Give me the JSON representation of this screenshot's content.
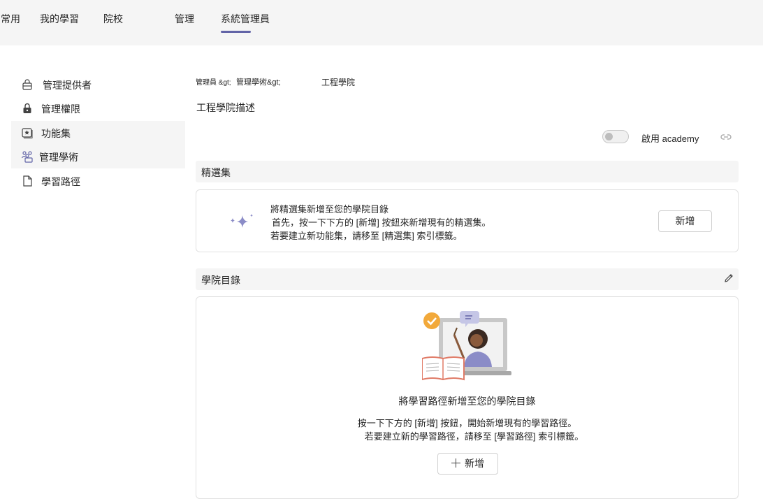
{
  "nav": {
    "tabs": [
      {
        "label": "常用"
      },
      {
        "label": "我的學習"
      },
      {
        "label": "院校"
      },
      {
        "label": "管理"
      },
      {
        "label": "系統管理員"
      }
    ],
    "active_tab": "系統管理員"
  },
  "sidebar": {
    "items": [
      {
        "label": "管理提供者",
        "icon": "provider-icon"
      },
      {
        "label": "管理權限",
        "icon": "lock-icon"
      },
      {
        "label": "功能集",
        "icon": "feature-set-icon"
      },
      {
        "label": "管理學術",
        "icon": "people-icon"
      },
      {
        "label": "學習路徑",
        "icon": "document-icon"
      }
    ],
    "selected": "管理學術"
  },
  "breadcrumb": {
    "part1": "管理員 &gt;",
    "part2": "管理學術&gt;",
    "current": "工程學院"
  },
  "academy": {
    "description": "工程學院描述",
    "toggle_label": "啟用 academy",
    "toggle_on": false
  },
  "featured": {
    "section_title": "精選集",
    "heading": "將精選集新增至您的學院目錄",
    "line1": "首先，按一下下方的 [新增] 按鈕來新增現有的精選集。",
    "line2": "若要建立新功能集，請移至 [精選集] 索引標籤。",
    "button_label": "新增"
  },
  "catalog": {
    "section_title": "學院目錄",
    "heading": "將學習路徑新增至您的學院目錄",
    "line1": "按一下下方的 [新增] 按鈕，開始新增現有的學習路徑。",
    "line2": "若要建立新的學習路徑，請移至 [學習路徑] 索引標籤。",
    "button_label": "新增"
  },
  "colors": {
    "accent": "#6264a7",
    "nav_bg": "#f5f5f5",
    "sparkle": "#8b8cc7"
  }
}
